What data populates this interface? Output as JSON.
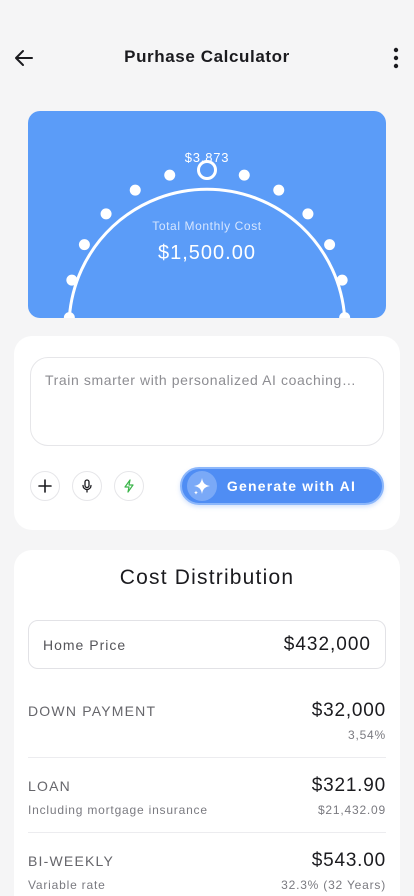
{
  "appbar": {
    "title": "Purhase Calculator",
    "back_icon": "arrow-left-icon",
    "menu_icon": "more-vertical-icon"
  },
  "gauge": {
    "selected_value": "$3,873",
    "label": "Total Monthly Cost",
    "amount": "$1,500.00",
    "background_color": "#5b9cf8",
    "level_fraction": 0.5,
    "tick_count": 13
  },
  "ai_prompt": {
    "placeholder": "Train smarter with personalized AI coaching…",
    "value": "",
    "add_icon": "plus-icon",
    "mic_icon": "microphone-icon",
    "bolt_icon": "lightning-icon",
    "generate_label": "Generate with AI",
    "generate_icon": "sparkle-icon",
    "accent_color": "#4f8df4"
  },
  "distribution": {
    "title": "Cost Distribution",
    "home_price": {
      "label": "Home Price",
      "value": "$432,000"
    },
    "rows": [
      {
        "label": "DOWN PAYMENT",
        "value": "$32,000",
        "sub_label": "",
        "sub_value": "3,54%"
      },
      {
        "label": "LOAN",
        "value": "$321.90",
        "sub_label": "Including mortgage insurance",
        "sub_value": "$21,432.09"
      },
      {
        "label": "BI-WEEKLY",
        "value": "$543.00",
        "sub_label": "Variable rate",
        "sub_value": "32.3% (32 Years)"
      }
    ]
  }
}
